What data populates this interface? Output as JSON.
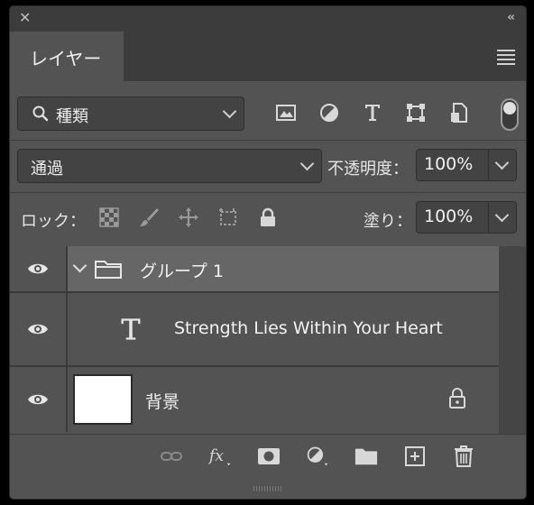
{
  "panel": {
    "tab_label": "レイヤー"
  },
  "filter": {
    "kind_label": "種類",
    "icons": [
      "image-filter-icon",
      "adjustment-filter-icon",
      "type-filter-icon",
      "shape-filter-icon",
      "smart-object-filter-icon"
    ]
  },
  "blend": {
    "mode": "通過",
    "opacity_label": "不透明度：",
    "opacity_value": "100%"
  },
  "lock": {
    "label": "ロック：",
    "fill_label": "塗り：",
    "fill_value": "100%"
  },
  "layers": [
    {
      "name": "グループ 1",
      "type": "group",
      "selected": true
    },
    {
      "name": "Strength Lies Within Your Heart",
      "type": "text"
    },
    {
      "name": "背景",
      "type": "background",
      "locked": true
    }
  ],
  "colors": {
    "panel_bg": "#535353",
    "dark_bg": "#3c3c3c",
    "selected_row": "#666666"
  }
}
